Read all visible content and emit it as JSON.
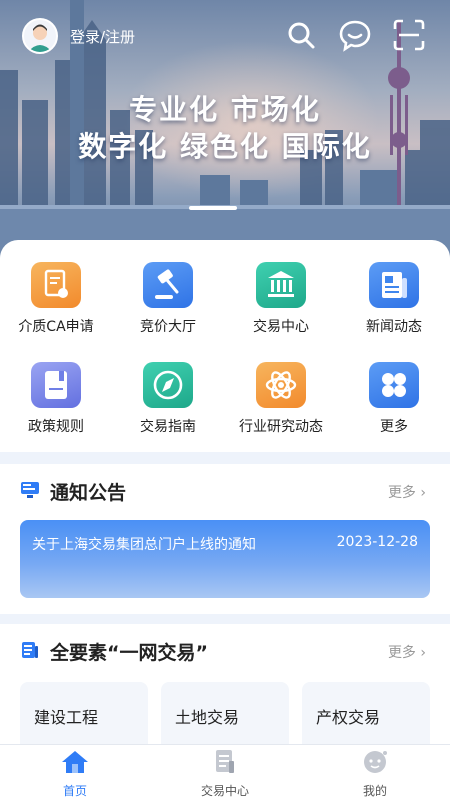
{
  "header": {
    "login_label": "登录/注册"
  },
  "banner": {
    "slogan_line1": "专业化 市场化",
    "slogan_line2": "数字化 绿色化 国际化"
  },
  "quick_menu": [
    {
      "label": "介质CA申请",
      "icon": "ca-certificate-icon",
      "color": "#f39a3c"
    },
    {
      "label": "竞价大厅",
      "icon": "auction-gavel-icon",
      "color": "#3f86ee"
    },
    {
      "label": "交易中心",
      "icon": "trading-center-icon",
      "color": "#27b89a"
    },
    {
      "label": "新闻动态",
      "icon": "newspaper-icon",
      "color": "#3f86ee"
    },
    {
      "label": "政策规则",
      "icon": "policy-book-icon",
      "color": "#6f7fe6"
    },
    {
      "label": "交易指南",
      "icon": "compass-icon",
      "color": "#27b89a"
    },
    {
      "label": "行业研究动态",
      "icon": "research-atom-icon",
      "color": "#f39a3c"
    },
    {
      "label": "更多",
      "icon": "more-grid-icon",
      "color": "#3f86ee"
    }
  ],
  "notice": {
    "title": "通知公告",
    "more_label": "更多",
    "item_text": "关于上海交易集团总门户上线的通知",
    "item_date": "2023-12-28"
  },
  "all_elements": {
    "title": "全要素“一网交易”",
    "more_label": "更多",
    "tiles": [
      "建设工程",
      "土地交易",
      "产权交易"
    ]
  },
  "tabbar": [
    {
      "label": "首页",
      "icon": "home-icon",
      "active": true
    },
    {
      "label": "交易中心",
      "icon": "document-icon",
      "active": false
    },
    {
      "label": "我的",
      "icon": "profile-face-icon",
      "active": false
    }
  ],
  "colors": {
    "accent": "#2f7cf6",
    "orange": "#f39a3c",
    "green": "#27b89a",
    "purple": "#6f7fe6"
  }
}
